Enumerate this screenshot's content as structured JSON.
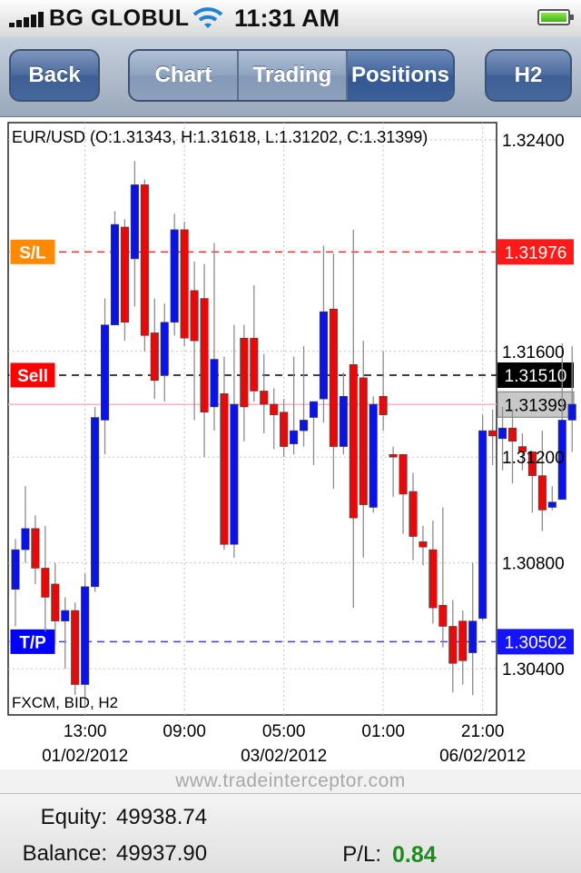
{
  "status": {
    "carrier": "BG GLOBUL",
    "time": "11:31 AM"
  },
  "nav": {
    "back": "Back",
    "tabs": [
      "Chart",
      "Trading",
      "Positions"
    ],
    "active_tab": "Positions",
    "timeframe": "H2"
  },
  "chart_data": {
    "type": "candlestick",
    "title": "EUR/USD (O:1.31343, H:1.31618, L:1.31202, C:1.31399)",
    "source_label": "FXCM, BID, H2",
    "y_ticks": [
      1.324,
      1.316,
      1.312,
      1.308,
      1.304
    ],
    "y_tick_labels": [
      "1.32400",
      "1.31600",
      "1.31200",
      "1.30800",
      "1.30400"
    ],
    "ylim": [
      1.30225,
      1.32465
    ],
    "x_ticks": [
      {
        "time": "13:00",
        "date": "01/02/2012",
        "index": 7
      },
      {
        "time": "09:00",
        "date": "",
        "index": 17
      },
      {
        "time": "05:00",
        "date": "03/02/2012",
        "index": 27
      },
      {
        "time": "01:00",
        "date": "",
        "index": 37
      },
      {
        "time": "21:00",
        "date": "06/02/2012",
        "index": 47
      }
    ],
    "levels": [
      {
        "name": "S/L",
        "value": 1.31976,
        "label": "1.31976",
        "color": "#ff2b2b",
        "tag_color": "#ff8a00",
        "style": "dashed"
      },
      {
        "name": "Sell",
        "value": 1.3151,
        "label": "1.31510",
        "color": "#000000",
        "tag_color": "#ff0000",
        "style": "dashed"
      },
      {
        "name": "",
        "value": 1.31399,
        "label": "1.31399",
        "color": "#ffb3c0",
        "tag_color": "#c8c8c8",
        "style": "solid"
      },
      {
        "name": "T/P",
        "value": 1.30502,
        "label": "1.30502",
        "color": "#3b3bff",
        "tag_color": "#0000ff",
        "style": "dashed"
      }
    ],
    "candles": [
      [
        1.307,
        1.3085,
        1.3056,
        1.3089
      ],
      [
        1.3085,
        1.3093,
        1.308,
        1.3109
      ],
      [
        1.3093,
        1.3078,
        1.3072,
        1.3098
      ],
      [
        1.3078,
        1.3067,
        1.3054,
        1.3094
      ],
      [
        1.3072,
        1.3058,
        1.3049,
        1.308
      ],
      [
        1.3058,
        1.3062,
        1.304,
        1.3067
      ],
      [
        1.3062,
        1.3034,
        1.303,
        1.3065
      ],
      [
        1.3034,
        1.3071,
        1.3026,
        1.3076
      ],
      [
        1.3071,
        1.3135,
        1.3069,
        1.3139
      ],
      [
        1.3134,
        1.317,
        1.3121,
        1.318
      ],
      [
        1.317,
        1.3208,
        1.317,
        1.3213
      ],
      [
        1.3207,
        1.3171,
        1.3164,
        1.321
      ],
      [
        1.3195,
        1.3223,
        1.3177,
        1.3232
      ],
      [
        1.3223,
        1.3166,
        1.316,
        1.3225
      ],
      [
        1.3167,
        1.3149,
        1.3142,
        1.318
      ],
      [
        1.3151,
        1.3171,
        1.3141,
        1.3178
      ],
      [
        1.3171,
        1.3206,
        1.3166,
        1.3212
      ],
      [
        1.3206,
        1.3165,
        1.3162,
        1.3209
      ],
      [
        1.3183,
        1.3164,
        1.3134,
        1.3194
      ],
      [
        1.318,
        1.3137,
        1.312,
        1.3193
      ],
      [
        1.3139,
        1.3157,
        1.313,
        1.3201
      ],
      [
        1.3144,
        1.3087,
        1.3085,
        1.3158
      ],
      [
        1.3087,
        1.314,
        1.3082,
        1.317
      ],
      [
        1.3165,
        1.3139,
        1.3126,
        1.317
      ],
      [
        1.3165,
        1.3145,
        1.3141,
        1.3185
      ],
      [
        1.3145,
        1.314,
        1.3129,
        1.3159
      ],
      [
        1.314,
        1.3136,
        1.3123,
        1.3146
      ],
      [
        1.3137,
        1.3124,
        1.312,
        1.3142
      ],
      [
        1.3125,
        1.313,
        1.3121,
        1.3158
      ],
      [
        1.313,
        1.3134,
        1.3124,
        1.3162
      ],
      [
        1.3135,
        1.3141,
        1.3117,
        1.3141
      ],
      [
        1.3142,
        1.3175,
        1.3133,
        1.32
      ],
      [
        1.3176,
        1.3124,
        1.3108,
        1.3197
      ],
      [
        1.3124,
        1.3143,
        1.3121,
        1.3152
      ],
      [
        1.3155,
        1.3097,
        1.3063,
        1.3206
      ],
      [
        1.315,
        1.3102,
        1.3082,
        1.3164
      ],
      [
        1.3101,
        1.314,
        1.3099,
        1.3143
      ],
      [
        1.3143,
        1.3136,
        1.313,
        1.316
      ],
      [
        1.3121,
        1.312,
        1.3105,
        1.3124
      ],
      [
        1.3121,
        1.3106,
        1.3091,
        1.3119
      ],
      [
        1.3107,
        1.309,
        1.3081,
        1.3114
      ],
      [
        1.3088,
        1.3086,
        1.3079,
        1.3094
      ],
      [
        1.3085,
        1.3063,
        1.3057,
        1.3096
      ],
      [
        1.3064,
        1.3056,
        1.3048,
        1.3101
      ],
      [
        1.3056,
        1.3042,
        1.3031,
        1.3066
      ],
      [
        1.3058,
        1.3043,
        1.3034,
        1.3062
      ],
      [
        1.3046,
        1.3058,
        1.303,
        1.308
      ],
      [
        1.3059,
        1.313,
        1.3058,
        1.3136
      ],
      [
        1.313,
        1.3128,
        1.3117,
        1.3138
      ],
      [
        1.3127,
        1.3131,
        1.3115,
        1.3139
      ],
      [
        1.3131,
        1.3126,
        1.311,
        1.3138
      ],
      [
        1.3124,
        1.3122,
        1.3115,
        1.3129
      ],
      [
        1.3122,
        1.3113,
        1.3099,
        1.3121
      ],
      [
        1.3113,
        1.31,
        1.3092,
        1.313
      ],
      [
        1.3101,
        1.3103,
        1.31,
        1.3109
      ],
      [
        1.3104,
        1.3134,
        1.3104,
        1.3163
      ],
      [
        1.3134,
        1.314,
        1.3122,
        1.3162
      ]
    ]
  },
  "footer": {
    "watermark": "www.tradeinterceptor.com",
    "equity_label": "Equity:",
    "equity_value": "49938.74",
    "balance_label": "Balance:",
    "balance_value": "49937.90",
    "pl_label": "P/L:",
    "pl_value": "0.84"
  }
}
